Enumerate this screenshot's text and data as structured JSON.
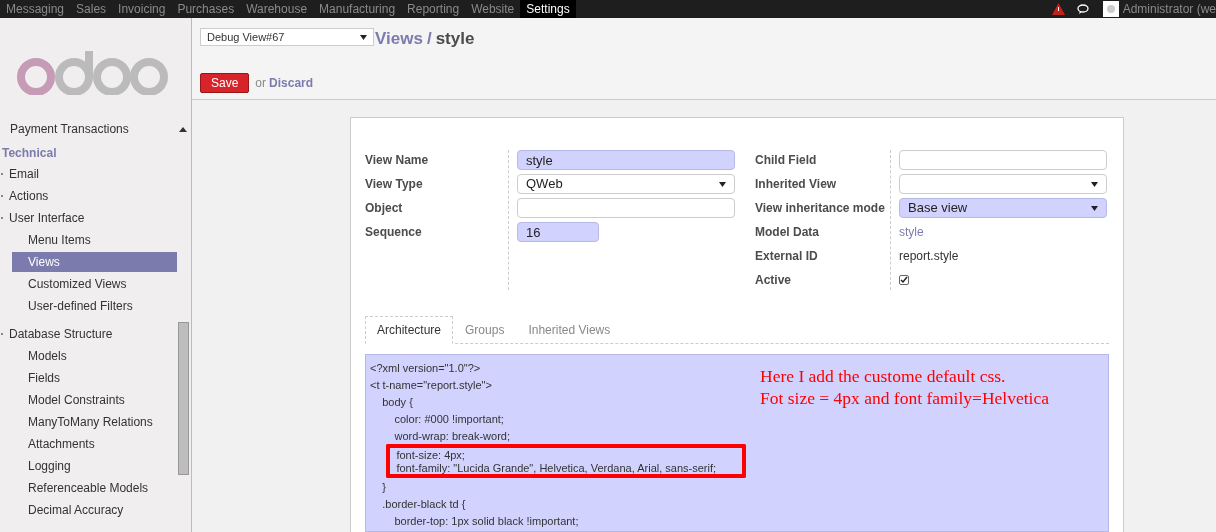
{
  "top_menu": [
    {
      "label": "Messaging",
      "selected": false
    },
    {
      "label": "Sales",
      "selected": false
    },
    {
      "label": "Invoicing",
      "selected": false
    },
    {
      "label": "Purchases",
      "selected": false
    },
    {
      "label": "Warehouse",
      "selected": false
    },
    {
      "label": "Manufacturing",
      "selected": false
    },
    {
      "label": "Reporting",
      "selected": false
    },
    {
      "label": "Website",
      "selected": false
    },
    {
      "label": "Settings",
      "selected": true
    }
  ],
  "user": {
    "name": "Administrator (we"
  },
  "sidebar": {
    "section": {
      "label": "Payment Transactions",
      "expanded": false
    },
    "heading": "Technical",
    "items": [
      {
        "label": "Email",
        "selected": false
      },
      {
        "label": "Actions",
        "selected": false
      },
      {
        "label": "User Interface",
        "selected": false,
        "children": [
          {
            "label": "Menu Items",
            "selected": false
          },
          {
            "label": "Views",
            "selected": true
          },
          {
            "label": "Customized Views",
            "selected": false
          },
          {
            "label": "User-defined Filters",
            "selected": false
          }
        ]
      },
      {
        "label": "Database Structure",
        "selected": false,
        "children": [
          {
            "label": "Models",
            "selected": false
          },
          {
            "label": "Fields",
            "selected": false
          },
          {
            "label": "Model Constraints",
            "selected": false
          },
          {
            "label": "ManyToMany Relations",
            "selected": false
          },
          {
            "label": "Attachments",
            "selected": false
          },
          {
            "label": "Logging",
            "selected": false
          },
          {
            "label": "Referenceable Models",
            "selected": false
          },
          {
            "label": "Decimal Accuracy",
            "selected": false
          }
        ]
      }
    ]
  },
  "debug_select": {
    "value": "Debug View#67"
  },
  "breadcrumb": {
    "parent": "Views",
    "separator": "/",
    "current": "style"
  },
  "actions": {
    "save": "Save",
    "or": "or",
    "discard": "Discard"
  },
  "form": {
    "left": [
      {
        "label": "View Name",
        "kind": "text",
        "value": "style",
        "required": true
      },
      {
        "label": "View Type",
        "kind": "select",
        "value": "QWeb",
        "required": false
      },
      {
        "label": "Object",
        "kind": "text",
        "required": false
      },
      {
        "label": "Sequence",
        "kind": "short",
        "value": "16",
        "required": true
      }
    ],
    "right": [
      {
        "label": "Child Field",
        "kind": "text",
        "required": false
      },
      {
        "label": "Inherited View",
        "kind": "select",
        "required": false
      },
      {
        "label": "View inheritance mode",
        "kind": "select",
        "value": "Base view",
        "required": true
      },
      {
        "label": "Model Data",
        "kind": "link",
        "value": "style"
      },
      {
        "label": "External ID",
        "kind": "readonly",
        "value": "report.style"
      },
      {
        "label": "Active",
        "kind": "checkbox",
        "checked": true
      }
    ]
  },
  "tabs": [
    {
      "label": "Architecture",
      "selected": true
    },
    {
      "label": "Groups",
      "selected": false
    },
    {
      "label": "Inherited Views",
      "selected": false
    }
  ],
  "code": [
    {
      "text": "<?xml version=\"1.0\"?>",
      "highlighted": false
    },
    {
      "text": "<t t-name=\"report.style\">",
      "highlighted": false
    },
    {
      "text": "    body {",
      "highlighted": false
    },
    {
      "text": "        color: #000 !important;",
      "highlighted": false
    },
    {
      "text": "        word-wrap: break-word;",
      "highlighted": false
    },
    {
      "text": "        font-size: 4px;",
      "highlighted": true
    },
    {
      "text": "        font-family: \"Lucida Grande\", Helvetica, Verdana, Arial, sans-serif;",
      "highlighted": true
    },
    {
      "text": "    }",
      "highlighted": false
    },
    {
      "text": "    .border-black td {",
      "highlighted": false
    },
    {
      "text": "        border-top: 1px solid black !important;",
      "highlighted": false
    }
  ],
  "annotation": [
    "Here I add the custome default css.",
    "Fot size = 4px and font family=Helvetica"
  ]
}
